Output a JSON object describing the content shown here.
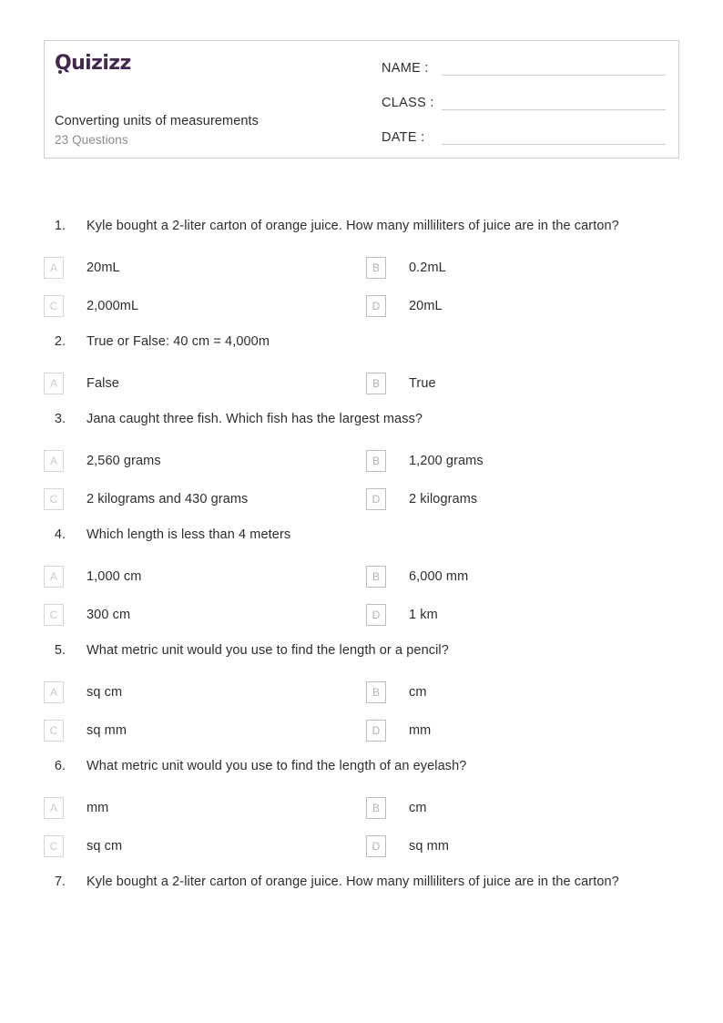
{
  "header": {
    "logo_text": "Quizizz",
    "logo_color": "#46274f",
    "title": "Converting units of measurements",
    "question_count_label": "23 Questions",
    "fields": [
      {
        "label": "NAME :",
        "value": ""
      },
      {
        "label": "CLASS :",
        "value": ""
      },
      {
        "label": "DATE  :",
        "value": ""
      }
    ]
  },
  "questions": [
    {
      "number": "1.",
      "text": "Kyle bought a 2-liter carton of orange juice. How many milliliters of juice are in the carton?",
      "options": [
        {
          "letter": "A",
          "text": "20mL"
        },
        {
          "letter": "B",
          "text": "0.2mL"
        },
        {
          "letter": "C",
          "text": "2,000mL"
        },
        {
          "letter": "D",
          "text": "20mL"
        }
      ]
    },
    {
      "number": "2.",
      "text": "True or False: 40 cm = 4,000m",
      "options": [
        {
          "letter": "A",
          "text": "False"
        },
        {
          "letter": "B",
          "text": "True"
        }
      ]
    },
    {
      "number": "3.",
      "text": "Jana caught three fish. Which fish has the largest mass?",
      "options": [
        {
          "letter": "A",
          "text": "2,560 grams"
        },
        {
          "letter": "B",
          "text": "1,200 grams"
        },
        {
          "letter": "C",
          "text": "2 kilograms and 430 grams"
        },
        {
          "letter": "D",
          "text": "2 kilograms"
        }
      ]
    },
    {
      "number": "4.",
      "text": "Which length is less than 4 meters",
      "options": [
        {
          "letter": "A",
          "text": "1,000 cm"
        },
        {
          "letter": "B",
          "text": "6,000 mm"
        },
        {
          "letter": "C",
          "text": "300 cm"
        },
        {
          "letter": "D",
          "text": "1 km"
        }
      ]
    },
    {
      "number": "5.",
      "text": "What metric unit would you use to find the length or a pencil?",
      "options": [
        {
          "letter": "A",
          "text": "sq cm"
        },
        {
          "letter": "B",
          "text": "cm"
        },
        {
          "letter": "C",
          "text": "sq mm"
        },
        {
          "letter": "D",
          "text": "mm"
        }
      ]
    },
    {
      "number": "6.",
      "text": "What metric unit would you use to find the length of an eyelash?",
      "options": [
        {
          "letter": "A",
          "text": "mm"
        },
        {
          "letter": "B",
          "text": "cm"
        },
        {
          "letter": "C",
          "text": "sq cm"
        },
        {
          "letter": "D",
          "text": "sq mm"
        }
      ]
    },
    {
      "number": "7.",
      "text": "Kyle bought a 2-liter carton of orange juice. How many milliliters of juice are in the carton?",
      "options": []
    }
  ]
}
